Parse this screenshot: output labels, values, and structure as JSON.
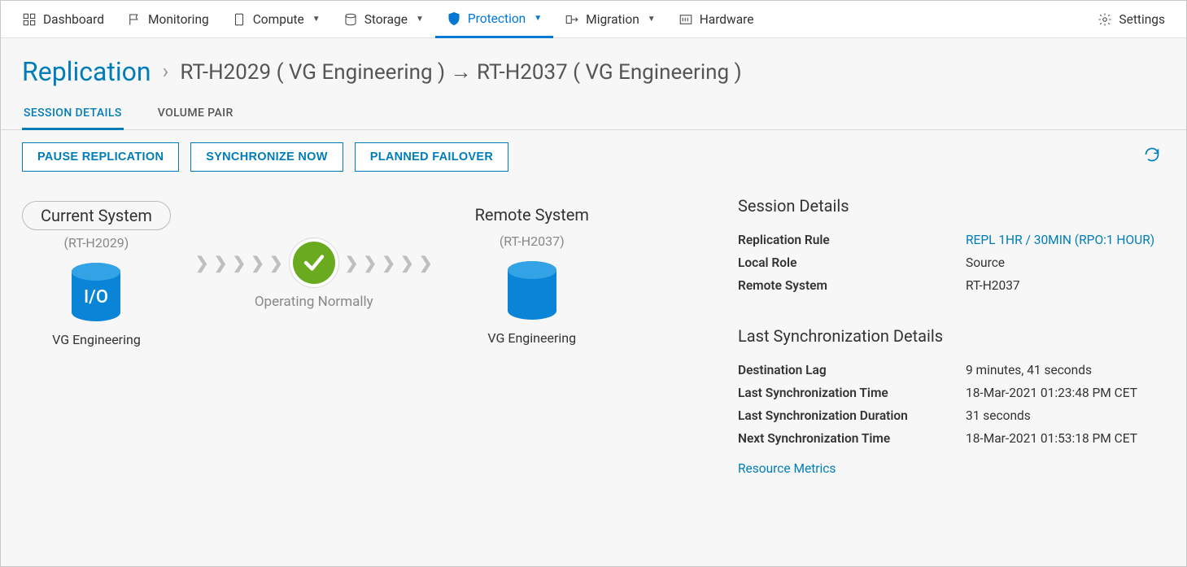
{
  "nav": {
    "dashboard": "Dashboard",
    "monitoring": "Monitoring",
    "compute": "Compute",
    "storage": "Storage",
    "protection": "Protection",
    "migration": "Migration",
    "hardware": "Hardware",
    "settings": "Settings"
  },
  "breadcrumb": {
    "root": "Replication",
    "path": "RT-H2029 ( VG Engineering ) → RT-H2037 ( VG Engineering )"
  },
  "tabs": {
    "session_details": "SESSION DETAILS",
    "volume_pair": "VOLUME PAIR"
  },
  "actions": {
    "pause": "PAUSE REPLICATION",
    "sync_now": "SYNCHRONIZE NOW",
    "planned_failover": "PLANNED FAILOVER"
  },
  "systems": {
    "current": {
      "title": "Current System",
      "id_display": "(RT-H2029)",
      "io_label": "I/O",
      "vg_label": "VG Engineering"
    },
    "status_text": "Operating Normally",
    "remote": {
      "title": "Remote System",
      "id_display": "(RT-H2037)",
      "vg_label": "VG Engineering"
    }
  },
  "details": {
    "session": {
      "title": "Session Details",
      "rows": {
        "rule_k": "Replication Rule",
        "rule_v": "REPL 1HR / 30MIN (RPO:1 HOUR)",
        "local_role_k": "Local Role",
        "local_role_v": "Source",
        "remote_sys_k": "Remote System",
        "remote_sys_v": "RT-H2037"
      }
    },
    "sync": {
      "title": "Last Synchronization Details",
      "rows": {
        "lag_k": "Destination Lag",
        "lag_v": "9 minutes, 41 seconds",
        "last_time_k": "Last Synchronization Time",
        "last_time_v": "18-Mar-2021 01:23:48 PM CET",
        "duration_k": "Last Synchronization Duration",
        "duration_v": "31 seconds",
        "next_time_k": "Next Synchronization Time",
        "next_time_v": "18-Mar-2021 01:53:18 PM CET"
      }
    },
    "resource_metrics": "Resource Metrics"
  }
}
